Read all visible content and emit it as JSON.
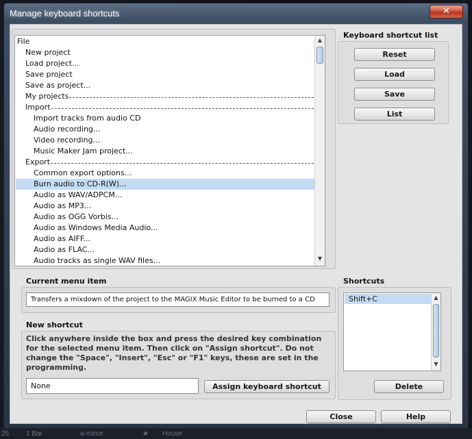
{
  "window": {
    "title": "Manage keyboard shortcuts",
    "close_glyph": "✕"
  },
  "menu_tree": {
    "items": [
      {
        "label": "File",
        "level": 0,
        "separator": false,
        "selected": false
      },
      {
        "label": "New project",
        "level": 1,
        "separator": false,
        "selected": false
      },
      {
        "label": "Load project...",
        "level": 1,
        "separator": false,
        "selected": false
      },
      {
        "label": "Save project",
        "level": 1,
        "separator": false,
        "selected": false
      },
      {
        "label": "Save as project...",
        "level": 1,
        "separator": false,
        "selected": false
      },
      {
        "label": "My projects",
        "level": 1,
        "separator": true,
        "selected": false
      },
      {
        "label": "Import",
        "level": 1,
        "separator": true,
        "selected": false
      },
      {
        "label": "Import tracks from audio CD",
        "level": 2,
        "separator": false,
        "selected": false
      },
      {
        "label": "Audio recording...",
        "level": 2,
        "separator": false,
        "selected": false
      },
      {
        "label": "Video recording...",
        "level": 2,
        "separator": false,
        "selected": false
      },
      {
        "label": "Music Maker Jam project...",
        "level": 2,
        "separator": false,
        "selected": false
      },
      {
        "label": "Export",
        "level": 1,
        "separator": true,
        "selected": false
      },
      {
        "label": "Common export options...",
        "level": 2,
        "separator": false,
        "selected": false
      },
      {
        "label": "Burn audio to CD-R(W)...",
        "level": 2,
        "separator": false,
        "selected": true
      },
      {
        "label": "Audio as WAV/ADPCM...",
        "level": 2,
        "separator": false,
        "selected": false
      },
      {
        "label": "Audio as MP3...",
        "level": 2,
        "separator": false,
        "selected": false
      },
      {
        "label": "Audio as OGG Vorbis...",
        "level": 2,
        "separator": false,
        "selected": false
      },
      {
        "label": "Audio as Windows Media Audio...",
        "level": 2,
        "separator": false,
        "selected": false
      },
      {
        "label": "Audio as AIFF...",
        "level": 2,
        "separator": false,
        "selected": false
      },
      {
        "label": "Audio as FLAC...",
        "level": 2,
        "separator": false,
        "selected": false
      },
      {
        "label": "Audio tracks as single WAV files...",
        "level": 2,
        "separator": false,
        "selected": false
      }
    ],
    "scroll_up_glyph": "▲",
    "scroll_down_glyph": "▼"
  },
  "shortcut_list_panel": {
    "title": "Keyboard shortcut list",
    "reset_label": "Reset",
    "load_label": "Load",
    "save_label": "Save",
    "list_label": "List"
  },
  "current_menu_item": {
    "title": "Current menu item",
    "value": "Transfers a mixdown of the project to the MAGIX Music Editor to be burned to a CD"
  },
  "new_shortcut": {
    "title": "New shortcut",
    "instructions": "Click anywhere inside the box and press the desired key combination for the selected menu item. Then click on \"Assign shortcut\". Do not change the \"Space\", \"Insert\", \"Esc\" or \"F1\" keys, these are set in the programming.",
    "field_value": "None",
    "assign_label": "Assign keyboard shortcut"
  },
  "shortcuts_panel": {
    "title": "Shortcuts",
    "items": [
      "Shift+C"
    ],
    "delete_label": "Delete"
  },
  "footer": {
    "close_label": "Close",
    "help_label": "Help"
  },
  "background_strip": {
    "number": "25",
    "bar": "1 Bar",
    "key": "a-minor",
    "star": "★",
    "house": "House"
  },
  "colors": {
    "selection": "#c4dcf3",
    "dialog_bg": "#e4e4e4",
    "title_bar": "#3d4d62",
    "close_button": "#c7452d"
  }
}
